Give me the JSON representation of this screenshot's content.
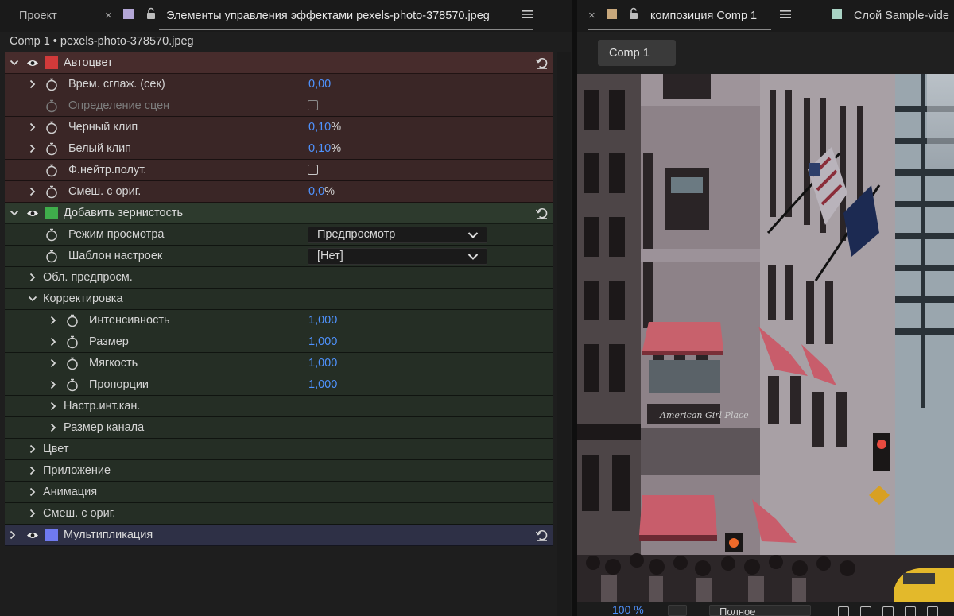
{
  "left_tabs": {
    "project_label": "Проект",
    "close_glyph": "×",
    "active_label": "Элементы управления эффектами pexels-photo-378570.jpeg",
    "swatch_color": "#b3a6d6"
  },
  "breadcrumb": "Comp 1 • pexels-photo-378570.jpeg",
  "effects": {
    "autocolor": {
      "name": "Автоцвет",
      "color": "#d23a3a",
      "props": [
        {
          "label": "Врем. сглаж. (сек)",
          "value": "0,00",
          "unit": ""
        },
        {
          "label": "Определение сцен"
        },
        {
          "label": "Черный клип",
          "value": "0,10",
          "unit": "%"
        },
        {
          "label": "Белый клип",
          "value": "0,10",
          "unit": "%"
        },
        {
          "label": "Ф.нейтр.полут."
        },
        {
          "label": "Смеш. с ориг.",
          "value": "0,0",
          "unit": "%"
        }
      ]
    },
    "grain": {
      "name": "Добавить зернистость",
      "color": "#3fae4b",
      "view_mode": {
        "label": "Режим просмотра",
        "value": "Предпросмотр"
      },
      "preset": {
        "label": "Шаблон настроек",
        "value": "[Нет]"
      },
      "preview_region": "Обл. предпросм.",
      "tweaking": {
        "label": "Корректировка",
        "props": [
          {
            "label": "Интенсивность",
            "value": "1,000"
          },
          {
            "label": "Размер",
            "value": "1,000"
          },
          {
            "label": "Мягкость",
            "value": "1,000"
          },
          {
            "label": "Пропорции",
            "value": "1,000"
          }
        ],
        "channel_intensity": "Настр.инт.кан.",
        "channel_size": "Размер канала"
      },
      "groups": [
        "Цвет",
        "Приложение",
        "Анимация",
        "Смеш. с ориг."
      ]
    },
    "multiply": {
      "name": "Мультипликация",
      "color": "#6f7af0"
    }
  },
  "right_tabs": {
    "comp_tab_label": "композиция Comp 1",
    "comp_swatch_color": "#c8a87c",
    "layer_tab_label": "Слой Sample-vide",
    "layer_swatch_color": "#a9d3c4",
    "comp_button": "Comp 1"
  },
  "viewer": {
    "awning_sign": "American Girl Place"
  },
  "bottom_bar": {
    "zoom": "100 %",
    "resolution": "Полное"
  }
}
